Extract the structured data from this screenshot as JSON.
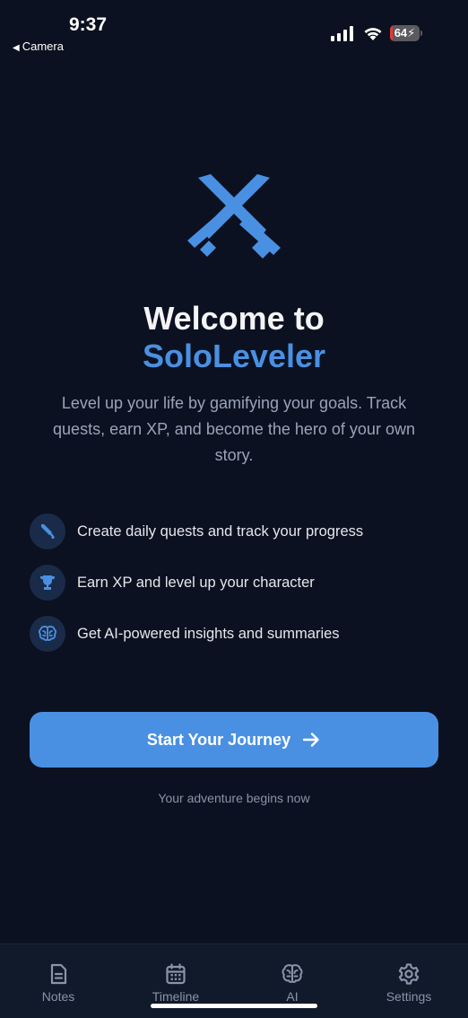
{
  "status_bar": {
    "time": "9:37",
    "back_label": "Camera",
    "battery_level": "64"
  },
  "welcome": {
    "title_line1": "Welcome to",
    "title_line2": "SoloLeveler",
    "description": "Level up your life by gamifying your goals. Track quests, earn XP, and become the hero of your own story."
  },
  "features": [
    {
      "icon": "sword-icon",
      "text": "Create daily quests and track your progress"
    },
    {
      "icon": "trophy-icon",
      "text": "Earn XP and level up your character"
    },
    {
      "icon": "brain-icon",
      "text": "Get AI-powered insights and summaries"
    }
  ],
  "cta": {
    "label": "Start Your Journey",
    "tagline": "Your adventure begins now"
  },
  "tab_bar": {
    "tabs": [
      {
        "label": "Notes",
        "icon": "note-icon"
      },
      {
        "label": "Timeline",
        "icon": "calendar-icon"
      },
      {
        "label": "AI",
        "icon": "brain-icon"
      },
      {
        "label": "Settings",
        "icon": "gear-icon"
      }
    ]
  },
  "colors": {
    "background": "#0b1120",
    "accent": "#4a90e2",
    "muted_text": "#9aa3b8",
    "tab_bar": "#111a2b"
  }
}
